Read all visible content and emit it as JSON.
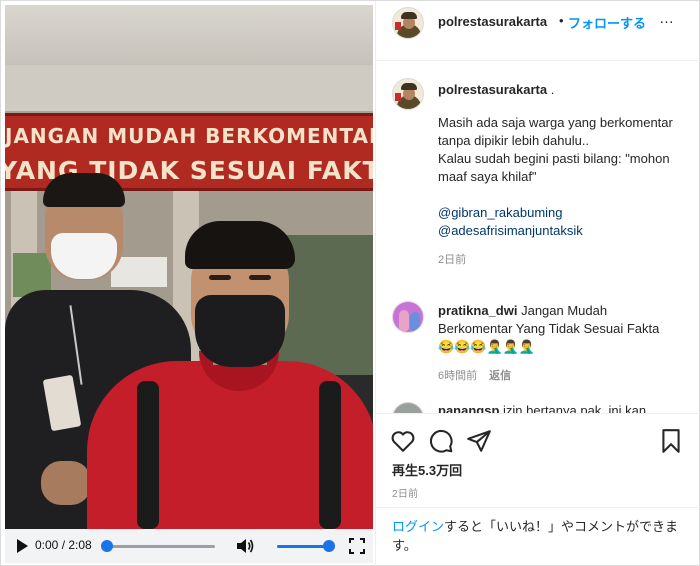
{
  "video": {
    "banner_line1": "JANGAN MUDAH BERKOMENTAR",
    "banner_line2": "YANG TIDAK SESUAI FAKTA",
    "time_display": "0:00 / 2:08",
    "progress": 0,
    "volume": 1
  },
  "header": {
    "username": "polrestasurakarta",
    "separator": "•",
    "follow_label": "フォローする",
    "more_label": "…"
  },
  "caption": {
    "username": "polrestasurakarta",
    "username_suffix": " .",
    "line1": "Masih ada saja warga yang berkomentar tanpa dipikir lebih dahulu..",
    "line2": "Kalau sudah begini pasti bilang: \"mohon maaf saya khilaf\"",
    "mention1": "@gibran_rakabuming",
    "mention2": "@adesafrisimanjuntaksik",
    "time": "2日前"
  },
  "comments": [
    {
      "username": "pratikna_dwi",
      "text": "Jangan Mudah Berkomentar Yang Tidak Sesuai Fakta 😂😂😂🤦‍♂️🤦‍♂️🤦‍♂️",
      "time": "6時間前",
      "reply_label": "返信"
    },
    {
      "username": "panangsp",
      "text": "izin bertanya pak, ini kan"
    }
  ],
  "actions": {
    "views": "再生5.3万回",
    "date": "2日前"
  },
  "login": {
    "link": "ログイン",
    "text": "すると「いいね！」やコメントができます。"
  },
  "colors": {
    "accent": "#0095f6",
    "banner": "#b12a22",
    "seek": "#1a73e8"
  }
}
